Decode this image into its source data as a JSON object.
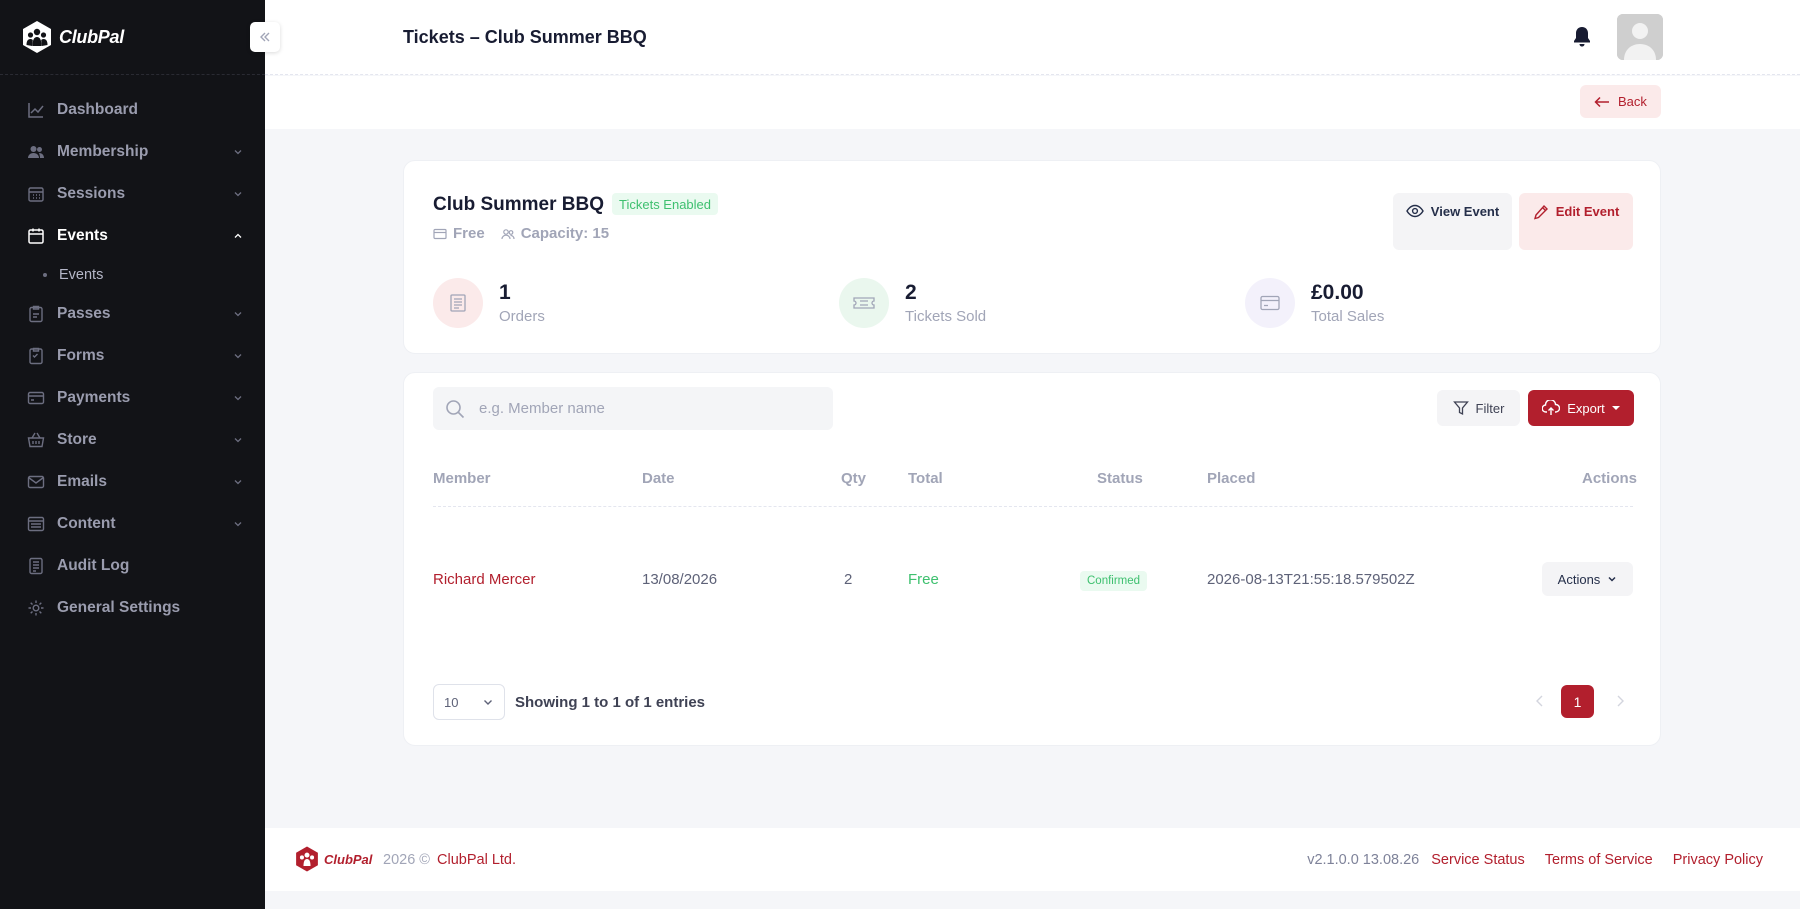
{
  "brand": {
    "name": "ClubPal"
  },
  "sidebar": {
    "items": [
      {
        "label": "Dashboard",
        "icon": "chart-line-icon",
        "expandable": false
      },
      {
        "label": "Membership",
        "icon": "users-icon",
        "expandable": true
      },
      {
        "label": "Sessions",
        "icon": "calendar-grid-icon",
        "expandable": true
      },
      {
        "label": "Events",
        "icon": "calendar-icon",
        "expandable": true,
        "active": true
      },
      {
        "label": "Passes",
        "icon": "clipboard-icon",
        "expandable": true
      },
      {
        "label": "Forms",
        "icon": "form-icon",
        "expandable": true
      },
      {
        "label": "Payments",
        "icon": "credit-card-icon",
        "expandable": true
      },
      {
        "label": "Store",
        "icon": "basket-icon",
        "expandable": true
      },
      {
        "label": "Emails",
        "icon": "mail-icon",
        "expandable": true
      },
      {
        "label": "Content",
        "icon": "content-icon",
        "expandable": true
      },
      {
        "label": "Audit Log",
        "icon": "log-icon",
        "expandable": false
      },
      {
        "label": "General Settings",
        "icon": "gear-icon",
        "expandable": false
      }
    ],
    "events_sub": "Events"
  },
  "header": {
    "title": "Tickets – Club Summer BBQ"
  },
  "toolbar": {
    "back_label": "Back"
  },
  "event": {
    "name": "Club Summer BBQ",
    "badge": "Tickets Enabled",
    "price": "Free",
    "capacity": "Capacity: 15",
    "view_label": "View Event",
    "edit_label": "Edit Event"
  },
  "stats": [
    {
      "value": "1",
      "caption": "Orders",
      "color": "#fbeaea"
    },
    {
      "value": "2",
      "caption": "Tickets Sold",
      "color": "#eaf7ee"
    },
    {
      "value": "£0.00",
      "caption": "Total Sales",
      "color": "#f3f1fb"
    }
  ],
  "orders": {
    "search_placeholder": "e.g. Member name",
    "filter_label": "Filter",
    "export_label": "Export",
    "columns": {
      "member": "Member",
      "date": "Date",
      "qty": "Qty",
      "total": "Total",
      "status": "Status",
      "placed": "Placed",
      "actions": "Actions"
    },
    "rows": [
      {
        "member": "Richard Mercer",
        "date": "13/08/2026",
        "qty": "2",
        "total": "Free",
        "status": "Confirmed",
        "placed": "2026-08-13T21:55:18.579502Z",
        "actions": "Actions"
      }
    ],
    "page_size": "10",
    "entries_text": "Showing 1 to 1 of 1 entries",
    "current_page": "1"
  },
  "footer": {
    "year": "2026 ©",
    "company": "ClubPal Ltd.",
    "version": "v2.1.0.0 13.08.26",
    "links": [
      "Service Status",
      "Terms of Service",
      "Privacy Policy"
    ]
  },
  "colors": {
    "accent": "#b21f2d",
    "sidebar_bg": "#121317",
    "success": "#3ec06f"
  }
}
